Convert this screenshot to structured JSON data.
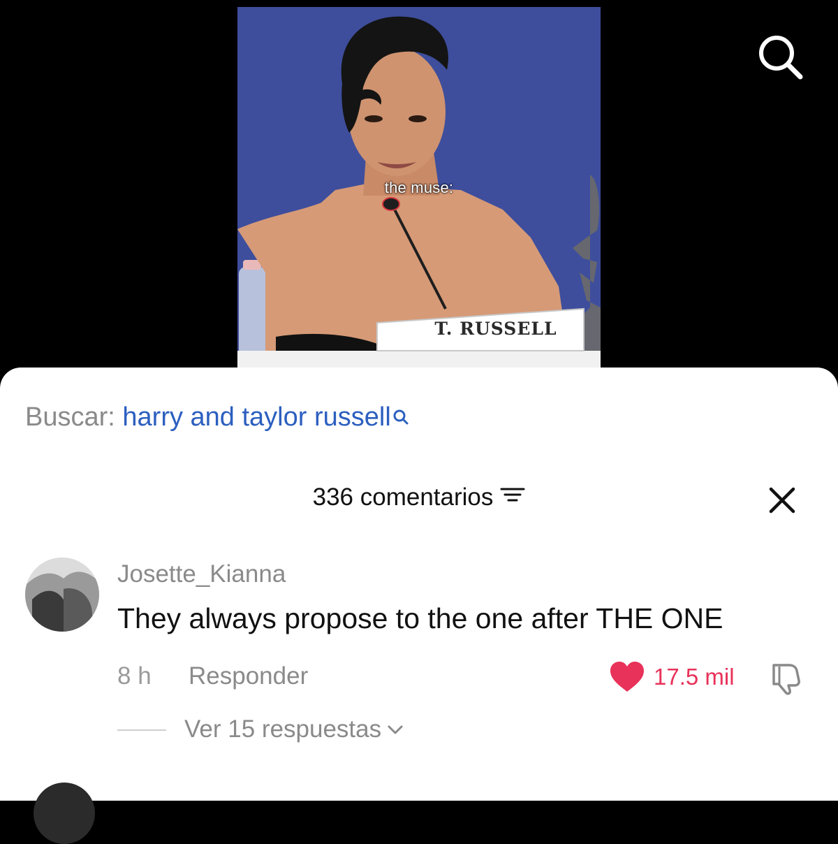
{
  "video": {
    "caption": "the muse:",
    "nameplate": "T. RUSSELL",
    "search_icon": "search-icon"
  },
  "search_suggestion": {
    "prefix": "Buscar:",
    "query": "harry and taylor russell"
  },
  "comments": {
    "header_count": "336 comentarios",
    "filter_icon": "filter-icon",
    "close_icon": "close-icon",
    "items": [
      {
        "username": "Josette_Kianna",
        "text": "They always propose to the one after THE ONE",
        "time": "8 h",
        "reply_label": "Responder",
        "likes": "17.5 mil",
        "view_replies": "Ver 15 respuestas"
      }
    ]
  },
  "colors": {
    "link_blue": "#2c5fbf",
    "like_red": "#e8325a",
    "muted_text": "#8a8a8a"
  }
}
